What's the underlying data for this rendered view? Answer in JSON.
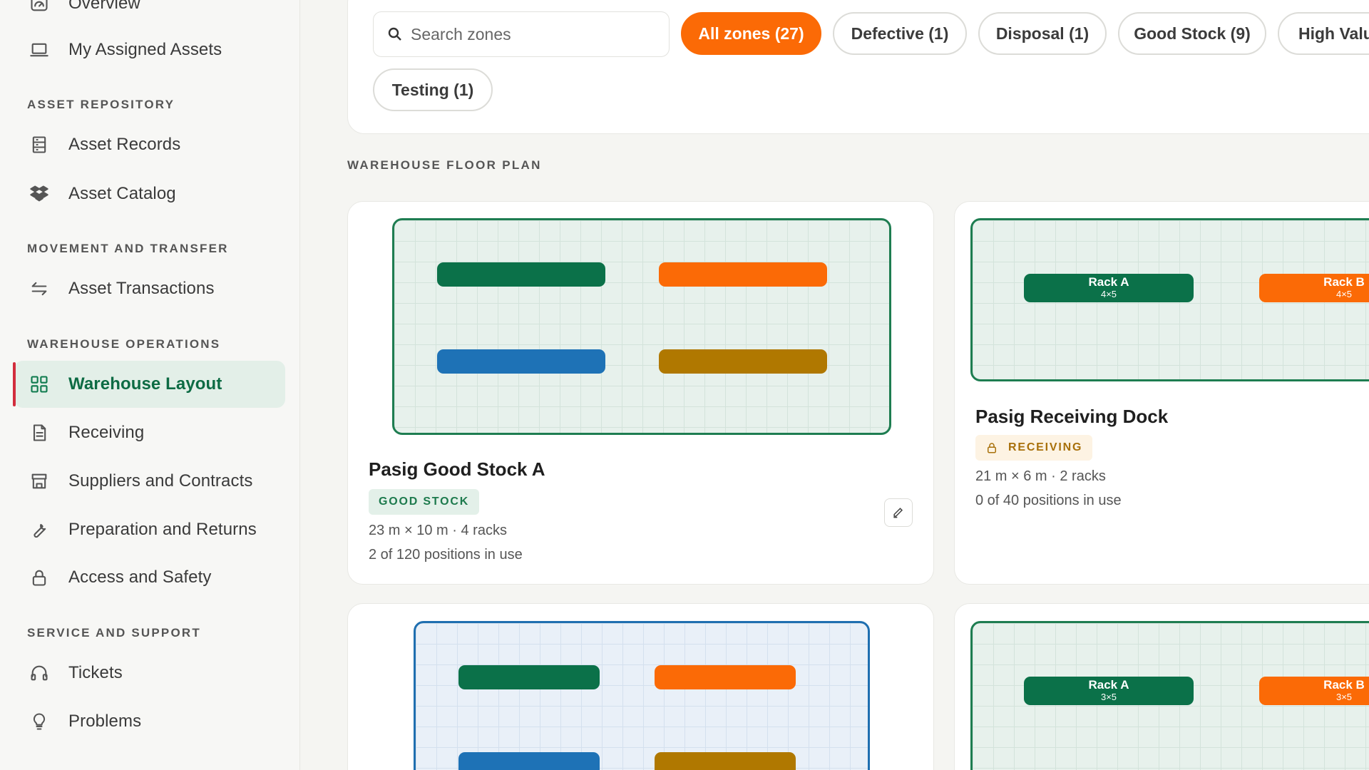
{
  "sidebar": {
    "items": [
      {
        "label": "Overview"
      },
      {
        "label": "My Assigned Assets"
      },
      {
        "label": "Asset Records"
      },
      {
        "label": "Asset Catalog"
      },
      {
        "label": "Asset Transactions"
      },
      {
        "label": "Warehouse Layout"
      },
      {
        "label": "Receiving"
      },
      {
        "label": "Suppliers and Contracts"
      },
      {
        "label": "Preparation and Returns"
      },
      {
        "label": "Access and Safety"
      },
      {
        "label": "Tickets"
      },
      {
        "label": "Problems"
      }
    ],
    "sections": [
      "ASSET REPOSITORY",
      "MOVEMENT AND TRANSFER",
      "WAREHOUSE OPERATIONS",
      "SERVICE AND SUPPORT"
    ],
    "active_item": "Warehouse Layout",
    "accent_color": "#0d6b44"
  },
  "filters": {
    "search_placeholder": "Search zones",
    "chips": [
      {
        "label": "All zones (27)",
        "active": true
      },
      {
        "label": "Defective (1)",
        "active": false
      },
      {
        "label": "Disposal (1)",
        "active": false
      },
      {
        "label": "Good Stock (9)",
        "active": false
      },
      {
        "label": "High Valu",
        "active": false
      },
      {
        "label": "Testing (1)",
        "active": false
      }
    ],
    "active_color": "#fb6a06"
  },
  "floor_plan": {
    "label": "WAREHOUSE FLOOR PLAN",
    "zones": [
      {
        "title": "Pasig Good Stock A",
        "badge": "GOOD STOCK",
        "meta1": "23 m × 10 m · 4 racks",
        "meta2": "2 of 120 positions in use"
      },
      {
        "title": "Pasig Receiving Dock",
        "badge": "RECEIVING",
        "meta1": "21 m × 6 m · 2 racks",
        "meta2": "0 of 40 positions in use",
        "racks": [
          {
            "name": "Rack A",
            "dims": "4×5"
          },
          {
            "name": "Rack B",
            "dims": "4×5"
          }
        ]
      },
      {
        "racks": [
          {
            "name": "Rack A",
            "dims": "3×5"
          },
          {
            "name": "Rack B",
            "dims": "3×5"
          }
        ]
      }
    ],
    "rack_colors": [
      "#0b7149",
      "#fb6a06",
      "#1e72b6",
      "#b07800"
    ]
  }
}
